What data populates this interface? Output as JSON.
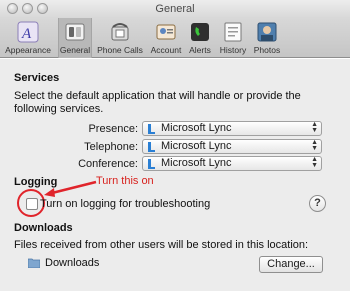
{
  "window": {
    "title": "General"
  },
  "toolbar": {
    "items": [
      {
        "label": "Appearance",
        "icon": "appearance-icon"
      },
      {
        "label": "General",
        "icon": "general-switch-icon",
        "selected": true
      },
      {
        "label": "Phone Calls",
        "icon": "phone-icon"
      },
      {
        "label": "Account",
        "icon": "account-icon"
      },
      {
        "label": "Alerts",
        "icon": "alerts-icon"
      },
      {
        "label": "History",
        "icon": "history-icon"
      },
      {
        "label": "Photos",
        "icon": "photos-icon"
      }
    ]
  },
  "services": {
    "heading": "Services",
    "description": "Select the default application that will handle or provide the following services.",
    "rows": [
      {
        "label": "Presence:",
        "value": "Microsoft Lync"
      },
      {
        "label": "Telephone:",
        "value": "Microsoft Lync"
      },
      {
        "label": "Conference:",
        "value": "Microsoft Lync"
      }
    ]
  },
  "logging": {
    "heading": "Logging",
    "annotation": "Turn this on",
    "checkbox_label": "Turn on logging for troubleshooting",
    "checked": false,
    "help": "?"
  },
  "downloads": {
    "heading": "Downloads",
    "description": "Files received from other users will be stored in this location:",
    "folder": "Downloads",
    "change_button": "Change..."
  },
  "colors": {
    "annotation": "#e0242b",
    "lync_blue": "#2a7fd4"
  }
}
